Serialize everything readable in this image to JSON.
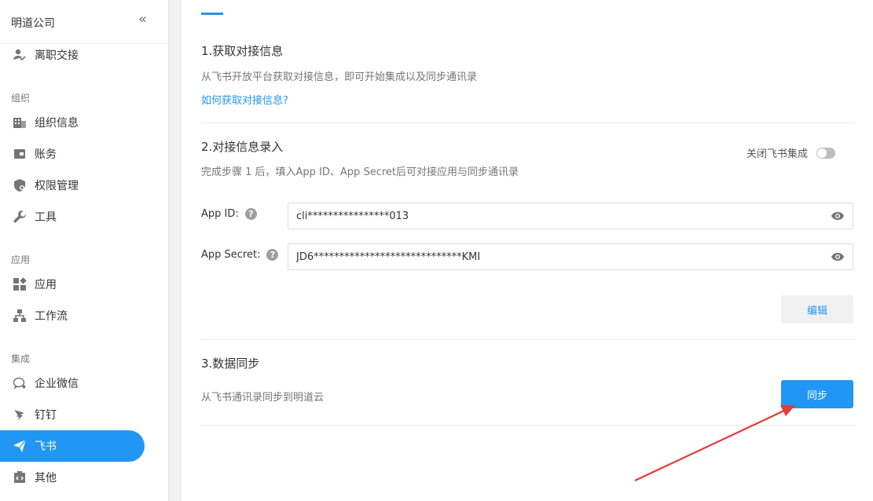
{
  "sidebar": {
    "company": "明道公司",
    "collapse_glyph": "«",
    "groups": {
      "org": "组织",
      "apps": "应用",
      "integration": "集成"
    },
    "items": {
      "resign": "离职交接",
      "org_info": "组织信息",
      "billing": "账务",
      "permission": "权限管理",
      "tools": "工具",
      "app": "应用",
      "workflow": "工作流",
      "wecom": "企业微信",
      "dingtalk": "钉钉",
      "feishu": "飞书",
      "other": "其他"
    },
    "active_item": "feishu",
    "accent_color": "#2196f3"
  },
  "main": {
    "section1": {
      "title": "1.获取对接信息",
      "desc": "从飞书开放平台获取对接信息，即可开始集成以及同步通讯录",
      "link": "如何获取对接信息?"
    },
    "section2": {
      "title": "2.对接信息录入",
      "desc": "完成步骤 1 后，填入App ID、App Secret后可对接应用与同步通讯录",
      "toggle_label": "关闭飞书集成",
      "toggle_on": false,
      "app_id_label": "App ID:",
      "app_id_value": "cli****************013",
      "app_secret_label": "App Secret:",
      "app_secret_value": "JD6*****************************KMI",
      "help_glyph": "?",
      "edit_button": "编辑"
    },
    "section3": {
      "title": "3.数据同步",
      "desc": "从飞书通讯录同步到明道云",
      "sync_button": "同步"
    }
  },
  "annotation": {
    "arrow_color": "#e53935"
  }
}
